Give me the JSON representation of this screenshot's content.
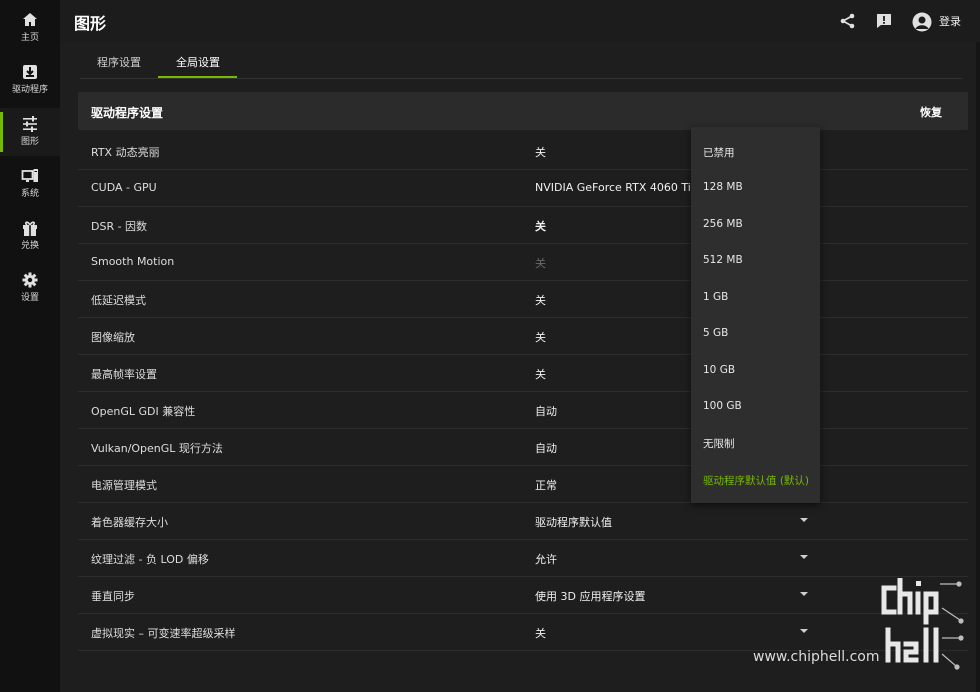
{
  "nav": {
    "items": [
      {
        "label": "主页",
        "icon": "home-icon"
      },
      {
        "label": "驱动程序",
        "icon": "download-icon"
      },
      {
        "label": "图形",
        "icon": "sliders-icon"
      },
      {
        "label": "系统",
        "icon": "monitor-icon"
      },
      {
        "label": "兑换",
        "icon": "gift-icon"
      },
      {
        "label": "设置",
        "icon": "gear-icon"
      }
    ],
    "active_index": 2
  },
  "header": {
    "title": "图形",
    "login_label": "登录",
    "icons": [
      "share-icon",
      "feedback-icon",
      "avatar-icon"
    ]
  },
  "tabs": [
    {
      "label": "程序设置"
    },
    {
      "label": "全局设置"
    }
  ],
  "active_tab": 1,
  "panel": {
    "title": "驱动程序设置",
    "restore_label": "恢复",
    "rows": [
      {
        "label": "RTX 动态亮丽",
        "value": "关"
      },
      {
        "label": "CUDA - GPU",
        "value": "NVIDIA GeForce RTX 4060 Ti"
      },
      {
        "label": "DSR - 因数",
        "value": "关"
      },
      {
        "label": "Smooth Motion",
        "value": "关"
      },
      {
        "label": "低延迟模式",
        "value": "关"
      },
      {
        "label": "图像缩放",
        "value": "关"
      },
      {
        "label": "最高帧率设置",
        "value": "关"
      },
      {
        "label": "OpenGL GDI 兼容性",
        "value": "自动"
      },
      {
        "label": "Vulkan/OpenGL 现行方法",
        "value": "自动"
      },
      {
        "label": "电源管理模式",
        "value": "正常"
      },
      {
        "label": "着色器缓存大小",
        "value": "驱动程序默认值"
      },
      {
        "label": "纹理过滤 - 负 LOD 偏移",
        "value": "允许"
      },
      {
        "label": "垂直同步",
        "value": "使用 3D 应用程序设置"
      },
      {
        "label": "虚拟现实 – 可变速率超级采样",
        "value": "关"
      }
    ]
  },
  "dropdown": {
    "options": [
      "已禁用",
      "128 MB",
      "256 MB",
      "512 MB",
      "1 GB",
      "5 GB",
      "10 GB",
      "100 GB",
      "无限制",
      "驱动程序默认值 (默认)"
    ],
    "selected_index": 9
  },
  "watermark": {
    "logo_text": "chip hell",
    "url": "www.chiphell.com"
  },
  "colors": {
    "accent": "#76b900",
    "background": "#1e1e1e",
    "rail": "#111111",
    "panel_header": "#2b2b2b",
    "dropdown": "#2e2e2e"
  }
}
